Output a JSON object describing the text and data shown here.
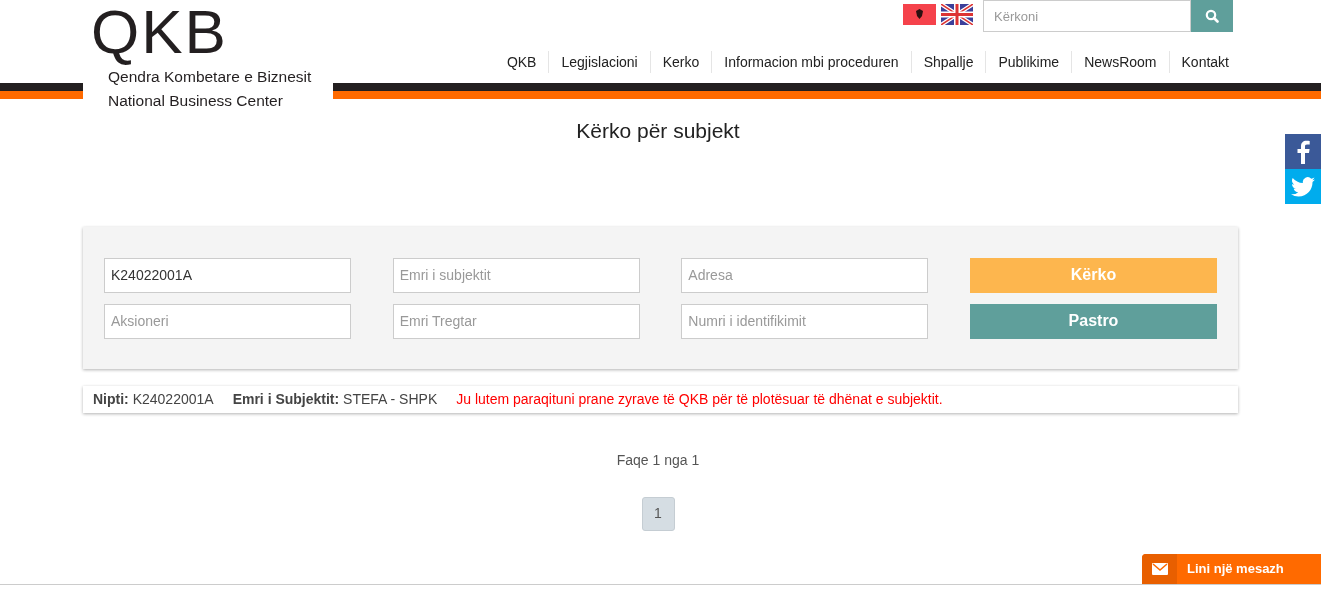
{
  "header": {
    "logo": {
      "text": "QKB",
      "subtitle": [
        "Qendra Kombetare e Biznesit",
        "National Business Center"
      ]
    },
    "search": {
      "placeholder": "Kërkoni"
    },
    "nav": [
      "QKB",
      "Legjislacioni",
      "Kerko",
      "Informacion mbi proceduren",
      "Shpallje",
      "Publikime",
      "NewsRoom",
      "Kontakt"
    ]
  },
  "title": "Kërko për subjekt",
  "form": {
    "fields": [
      {
        "value": "K24022001A"
      },
      {
        "placeholder": "Emri i subjektit"
      },
      {
        "placeholder": "Adresa"
      },
      {
        "placeholder": "Aksioneri"
      },
      {
        "placeholder": "Emri Tregtar"
      },
      {
        "placeholder": "Numri i identifikimit"
      }
    ],
    "buttons": [
      {
        "label": "Kërko",
        "kind": "primary"
      },
      {
        "label": "Pastro",
        "kind": "secondary"
      }
    ]
  },
  "result": {
    "items": [
      "**Nipti:** K24022001A",
      "**Emri i Subjektit:** STEFA - SHPK"
    ],
    "message": "Ju lutem paraqituni prane zyrave të QKB për të plotësuar të dhënat e subjektit."
  },
  "pagination": {
    "summary": "Faqe 1 nga 1",
    "pages": [
      {
        "label": "1",
        "selected": true
      }
    ]
  },
  "chat": {
    "label": "Lini një mesazh"
  }
}
